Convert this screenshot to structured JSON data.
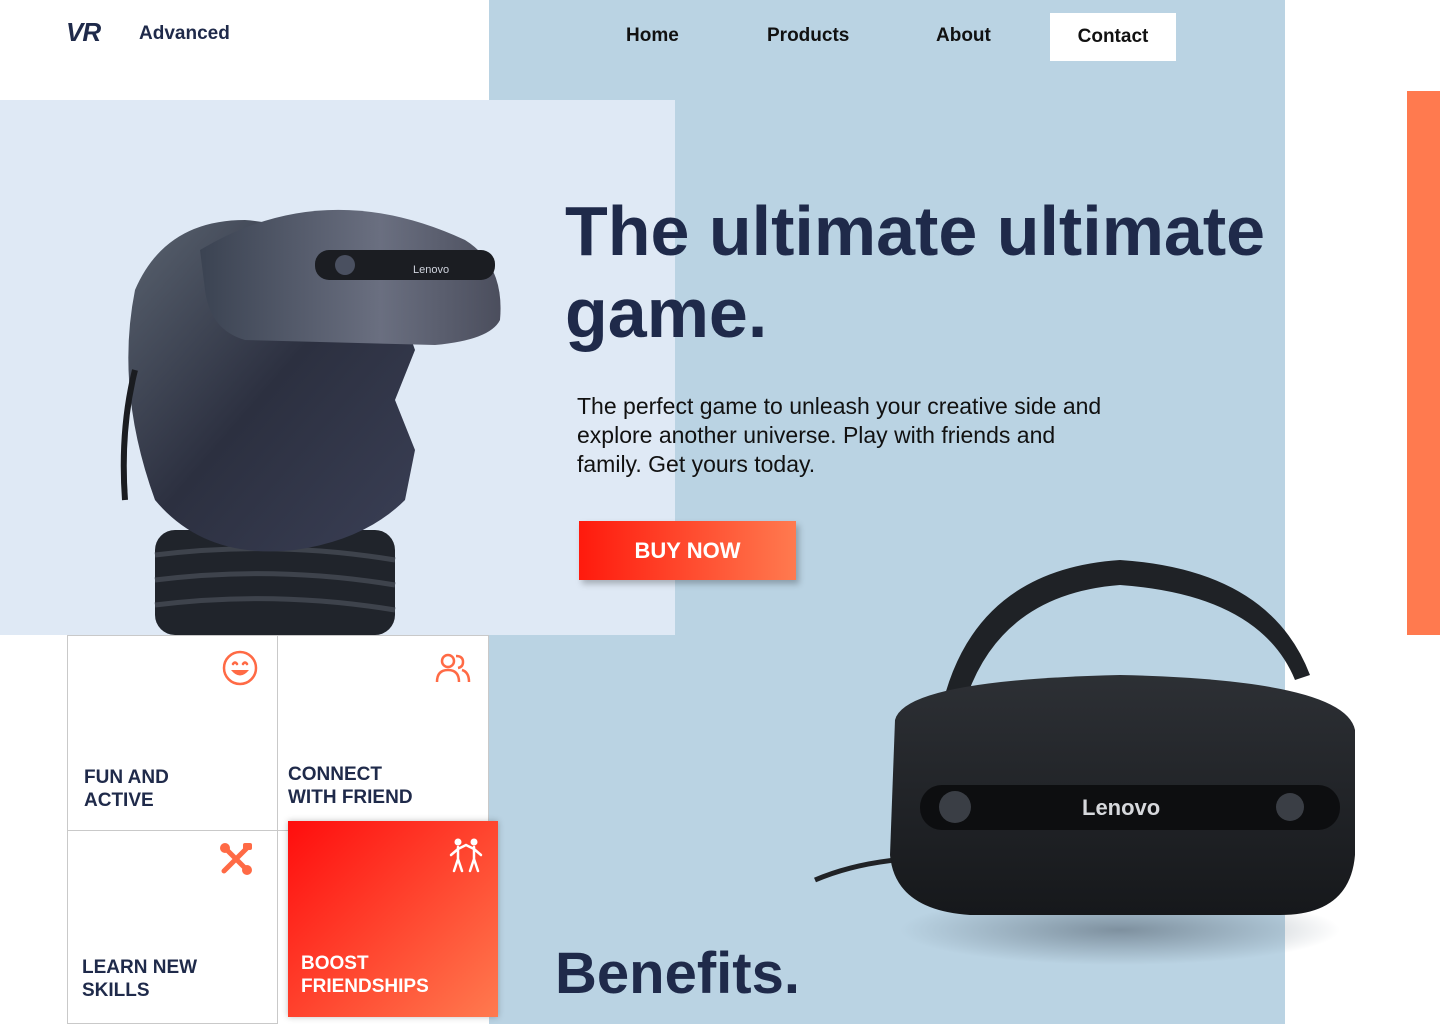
{
  "brand": {
    "mark": "VR",
    "name": "Advanced"
  },
  "nav": {
    "items": [
      "Home",
      "Products",
      "About",
      "Contact"
    ],
    "active": "Contact"
  },
  "hero": {
    "headline": "The ultimate ultimate game.",
    "description": "The perfect game to unleash your creative side and explore another universe. Play with friends and family. Get yours today.",
    "cta_label": "BUY NOW"
  },
  "benefits": {
    "title": "Benefits.",
    "cards": [
      {
        "label": "FUN AND\nACTIVE",
        "icon": "smile-icon"
      },
      {
        "label": "CONNECT\nWITH FRIEND",
        "icon": "users-icon"
      },
      {
        "label": "LEARN NEW\nSKILLS",
        "icon": "tools-icon"
      },
      {
        "label": "BOOST\nFRIENDSHIPS",
        "icon": "friends-icon"
      }
    ]
  },
  "images": {
    "headset_brand_text": "Lenovo"
  },
  "colors": {
    "navy": "#1f2a4a",
    "accent_orange": "#ff7a4f",
    "accent_red": "#ff1a0d",
    "panel_blue": "#bad3e3",
    "panel_light": "#dfe9f5"
  }
}
